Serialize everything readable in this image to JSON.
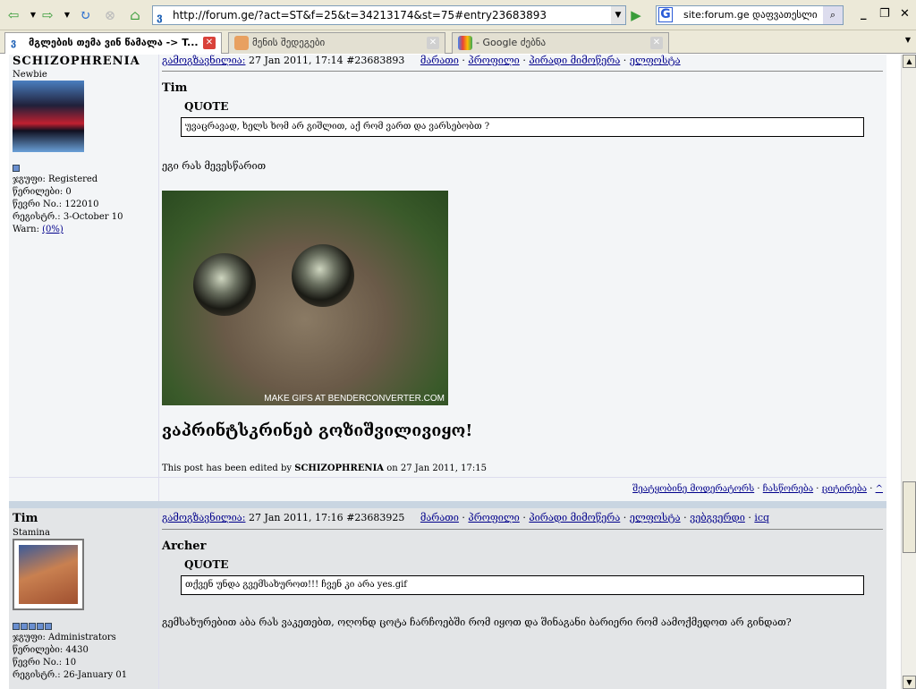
{
  "browser": {
    "url": "http://forum.ge/?act=ST&f=25&t=34213174&st=75#entry23683893",
    "search_value": "site:forum.ge დაფვათესლი",
    "tabs": [
      {
        "label": "მგლების თემა ვინ წამალა -> T..."
      },
      {
        "label": "მენის შედეგები"
      },
      {
        "label": "- Google ძებნა"
      }
    ]
  },
  "post_links": {
    "send_message": "მარათი",
    "profile": "პროფილი",
    "private_message": "პირადი მიმოწერა",
    "email": "ელფოსტა",
    "website": "ვებგვერდი",
    "icq": "icq",
    "posted": "გამოგზავნილია:"
  },
  "posts": [
    {
      "author": "SCHIZOPHRENIA",
      "rank": "Newbie",
      "group": "ჯგუფი: Registered",
      "posts_count": "წერილები: 0",
      "member_no": "წევრი No.: 122010",
      "registered": "რეგისტრ.: 3-October 10",
      "warn_label": "Warn:",
      "warn_value": "(0%)",
      "date": "27 Jan 2011, 17:14",
      "entry": "#23683893",
      "quote_author": "Tim",
      "quote_label": "QUOTE",
      "quote_text": "უვაცრავად, ხელს ხომ არ გიშლით, აქ რომ ვართ და ვარსებობთ ?",
      "body": "ეგი რას მევესწარით",
      "gif_caption": "MAKE GIFS AT BENDERCONVERTER.COM",
      "big_text": "ვაპრინტსკრინებ გოზიშვილივიყო!",
      "edit_prefix": "This post has been edited by",
      "edit_user": "SCHIZOPHRENIA",
      "edit_suffix": "on 27 Jan 2011, 17:15",
      "footer": {
        "report": "შეატყობინე მოდერატორს",
        "edit": "ჩასწორება",
        "quote": "ციტირება",
        "top": "^"
      }
    },
    {
      "author": "Tim",
      "rank": "Stamina",
      "group": "ჯგუფი: Administrators",
      "posts_count": "წერილები: 4430",
      "member_no": "წევრი No.: 10",
      "registered": "რეგისტრ.: 26-January 01",
      "date": "27 Jan 2011, 17:16",
      "entry": "#23683925",
      "quote_author": "Archer",
      "quote_label": "QUOTE",
      "quote_text": "თქვენ უნდა გვემსახუროთ!!! ჩვენ კი არა yes.gif",
      "body": "გემსახურებით აბა რას ვაკეთებთ, ოღონდ ცოტა ჩარჩოებში რომ იყოთ და შინაგანი ბარიერი რომ აამოქმედოთ არ გინდათ?"
    }
  ]
}
